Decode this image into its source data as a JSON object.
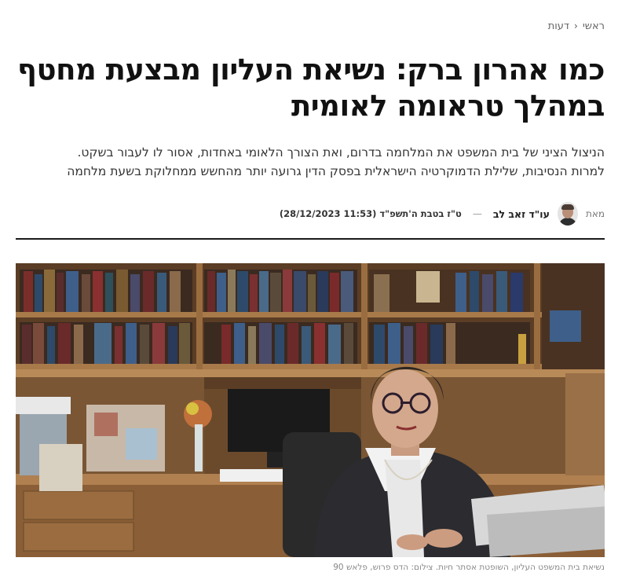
{
  "breadcrumb": {
    "home": "ראשי",
    "section": "דעות"
  },
  "headline": "כמו אהרון ברק: נשיאת העליון מבצעת מחטף במהלך טראומה לאומית",
  "subheadline": {
    "line1": "הניצול הציני של בית המשפט את המלחמה בדרום, ואת הצורך הלאומי באחדות, אסור לו לעבור בשקט.",
    "line2": "למרות הנסיבות, שלילת הדמוקרטיה הישראלית בפסק הדין גרועה יותר מהחשש ממחלוקת בשעת מלחמה"
  },
  "byline": {
    "prefix": "מאת",
    "author": "עו\"ד זאב לב",
    "date": "ט\"ז בטבת ה'תשפ\"ד (11:53 28/12/2023)"
  },
  "photo": {
    "caption": "נשיאת בית המשפט העליון, השופטת אסתר חיות. צילום: הדס פרוש, פלאש 90"
  },
  "icons": {
    "breadcrumb_separator": "chevron-left-icon",
    "author_avatar": "avatar-icon"
  }
}
